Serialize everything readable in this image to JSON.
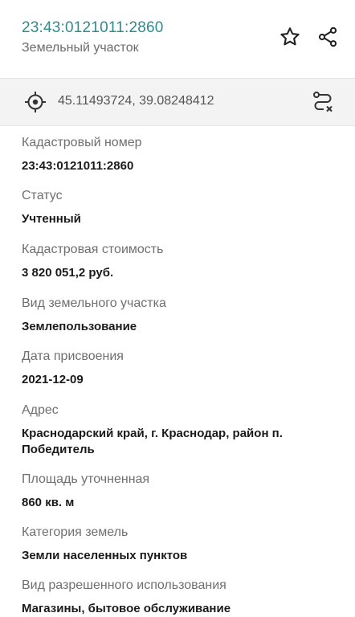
{
  "header": {
    "title": "23:43:0121011:2860",
    "subtitle": "Земельный участок",
    "icons": [
      "star-icon",
      "share-icon"
    ]
  },
  "coords": {
    "text": "45.11493724, 39.08248412",
    "icons": [
      "target-icon",
      "route-icon"
    ]
  },
  "fields": [
    {
      "label": "Кадастровый номер",
      "value": "23:43:0121011:2860"
    },
    {
      "label": "Статус",
      "value": "Учтенный"
    },
    {
      "label": "Кадастровая стоимость",
      "value": "3 820 051,2 руб."
    },
    {
      "label": "Вид земельного участка",
      "value": "Землепользование"
    },
    {
      "label": "Дата присвоения",
      "value": "2021-12-09"
    },
    {
      "label": "Адрес",
      "value": "Краснодарский край, г. Краснодар, район п. Победитель"
    },
    {
      "label": "Площадь уточненная",
      "value": "860 кв. м"
    },
    {
      "label": "Категория земель",
      "value": "Земли населенных пунктов"
    },
    {
      "label": "Вид разрешенного использования",
      "value": "Магазины, бытовое обслуживание"
    }
  ],
  "colors": {
    "title": "#2e8a8e",
    "bar": "#f3f3f3"
  }
}
